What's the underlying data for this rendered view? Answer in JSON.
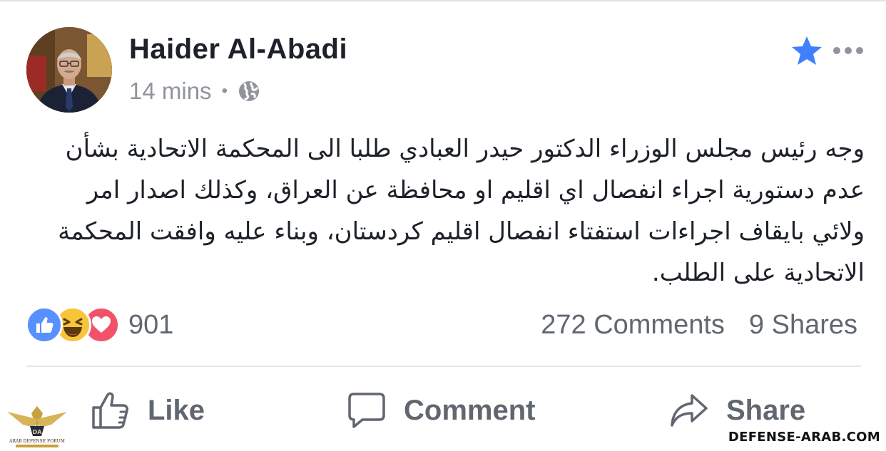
{
  "post": {
    "author": "Haider Al-Abadi",
    "time": "14 mins",
    "separator": "•",
    "privacy_icon": "globe-icon",
    "text": "وجه رئيس مجلس الوزراء الدكتور حيدر العبادي طلبا الى المحكمة الاتحادية بشأن عدم دستورية اجراء انفصال اي اقليم او محافظة عن العراق، وكذلك اصدار امر ولائي بايقاف اجراءات استفتاء انفصال اقليم كردستان، وبناء عليه وافقت المحكمة الاتحادية على الطلب."
  },
  "header_actions": {
    "favorite_icon": "star-icon",
    "more_icon": "more-dots-icon"
  },
  "engagement": {
    "reactions": [
      "like",
      "haha",
      "love"
    ],
    "reaction_count": "901",
    "comments": "272 Comments",
    "shares": "9 Shares"
  },
  "actions": {
    "like": "Like",
    "comment": "Comment",
    "share": "Share"
  },
  "watermark": {
    "site": "DEFENSE-ARAB.COM",
    "logo_text": "ARAB DEFENSE FORUM"
  },
  "colors": {
    "accent_blue": "#4080ff",
    "like_blue": "#5890ff",
    "love_red": "#f25268",
    "haha_yellow": "#f7c43a",
    "secondary_text": "#90949c",
    "action_gray": "#606770"
  }
}
